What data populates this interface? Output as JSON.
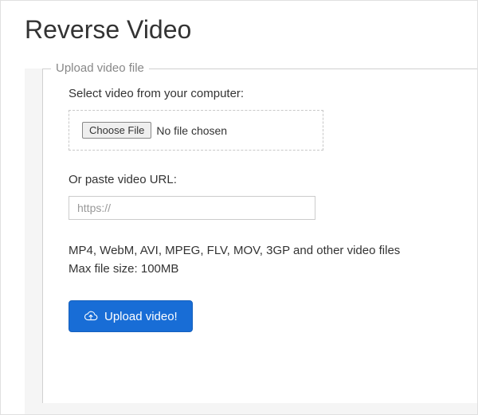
{
  "page_title": "Reverse Video",
  "fieldset_legend": "Upload video file",
  "select_label": "Select video from your computer:",
  "choose_file_label": "Choose File",
  "file_status": "No file chosen",
  "url_label": "Or paste video URL:",
  "url_placeholder": "https://",
  "formats_text": "MP4, WebM, AVI, MPEG, FLV, MOV, 3GP and other video files",
  "max_size_text": "Max file size: 100MB",
  "upload_button_label": "Upload video!"
}
